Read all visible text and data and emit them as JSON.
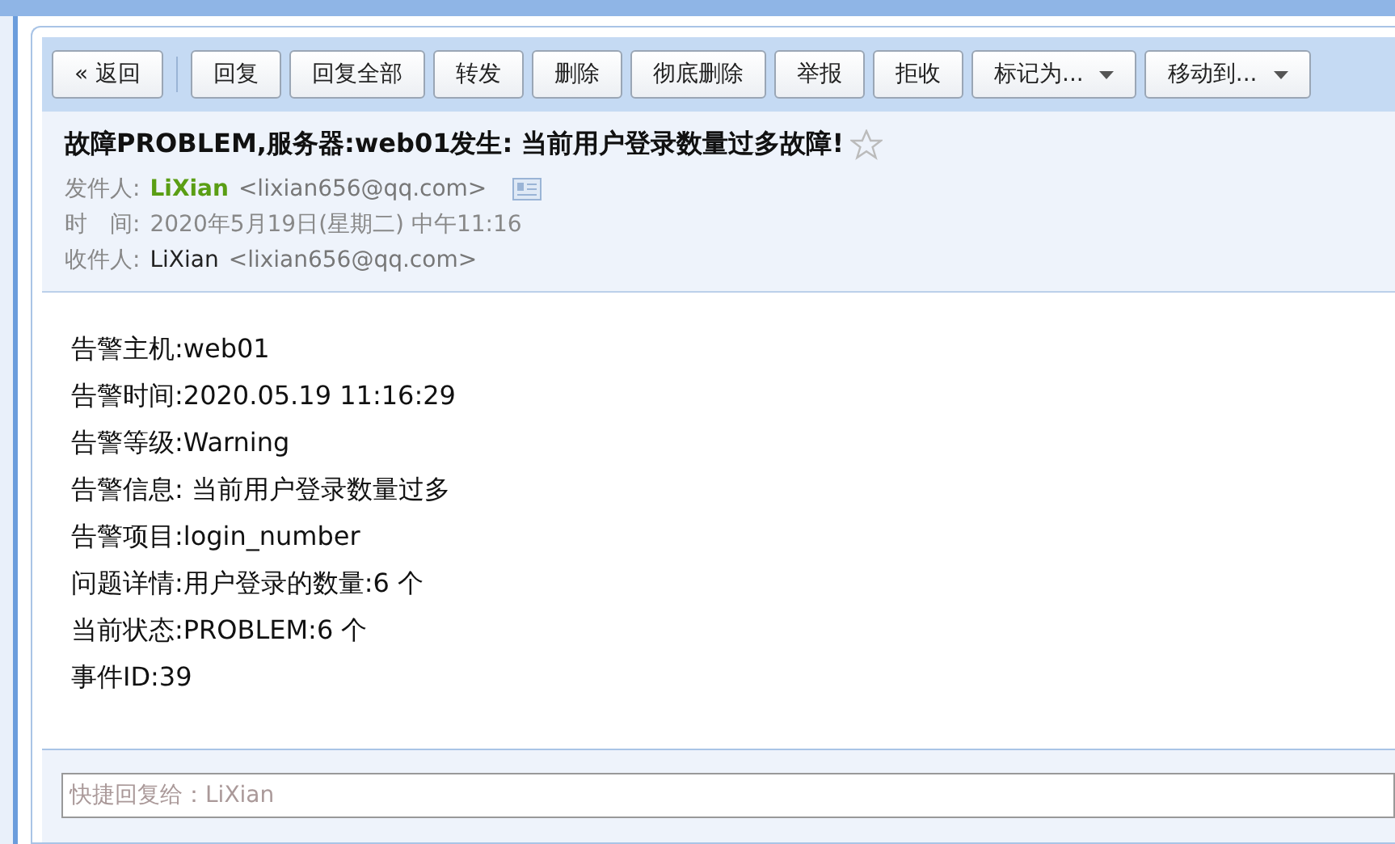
{
  "toolbar": {
    "back_button": "« 返回",
    "buttons": [
      {
        "label": "回复",
        "kind": "plain"
      },
      {
        "label": "回复全部",
        "kind": "plain"
      },
      {
        "label": "转发",
        "kind": "plain"
      },
      {
        "label": "删除",
        "kind": "plain"
      },
      {
        "label": "彻底删除",
        "kind": "plain"
      },
      {
        "label": "举报",
        "kind": "plain"
      },
      {
        "label": "拒收",
        "kind": "plain"
      },
      {
        "label": "标记为...",
        "kind": "dropdown"
      },
      {
        "label": "移动到...",
        "kind": "dropdown"
      }
    ]
  },
  "header": {
    "subject": "故障PROBLEM,服务器:web01发生: 当前用户登录数量过多故障!",
    "starred": false,
    "fields": [
      {
        "label": "发件人:",
        "name": "LiXian",
        "address": "<lixian656@qq.com>",
        "kind": "sender"
      },
      {
        "label": "时　间:",
        "value": "2020年5月19日(星期二) 中午11:16",
        "kind": "text"
      },
      {
        "label": "收件人:",
        "name": "LiXian",
        "address": "<lixian656@qq.com>",
        "kind": "recipient"
      }
    ]
  },
  "body": [
    "告警主机:web01",
    "告警时间:2020.05.19 11:16:29",
    "告警等级:Warning",
    "告警信息: 当前用户登录数量过多",
    "告警项目:login_number",
    "问题详情:用户登录的数量:6 个",
    "当前状态:PROBLEM:6 个",
    "事件ID:39"
  ],
  "quick_reply": {
    "placeholder": "快捷回复给：LiXian"
  }
}
